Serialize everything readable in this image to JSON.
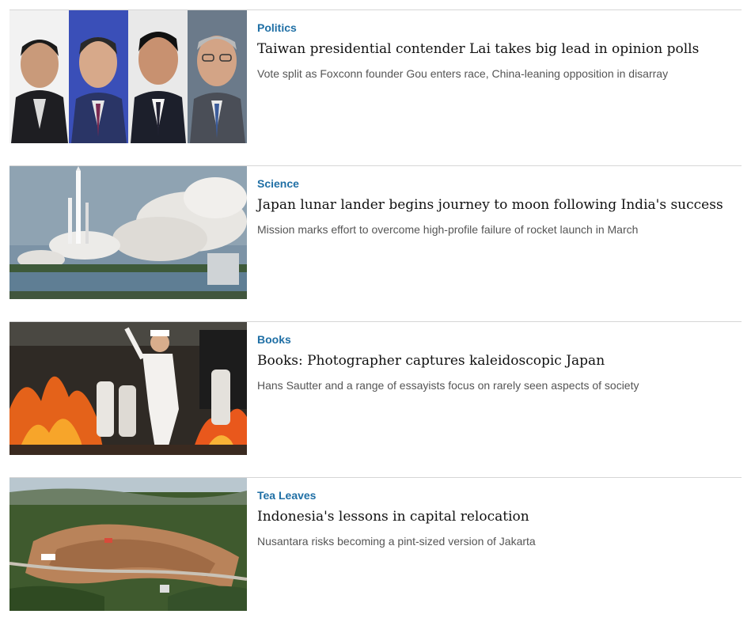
{
  "articles": [
    {
      "category": "Politics",
      "headline": "Taiwan presidential contender Lai takes big lead in opinion polls",
      "summary": "Vote split as Foxconn founder Gou enters race, China-leaning opposition in disarray",
      "image": "four-politicians-portraits"
    },
    {
      "category": "Science",
      "headline": "Japan lunar lander begins journey to moon following India's success",
      "summary": "Mission marks effort to overcome high-profile failure of rocket launch in March",
      "image": "rocket-launch-coastline"
    },
    {
      "category": "Books",
      "headline": "Books: Photographer captures kaleidoscopic Japan",
      "summary": "Hans Sautter and a range of essayists focus on rarely seen aspects of society",
      "image": "fire-walking-festival"
    },
    {
      "category": "Tea Leaves",
      "headline": "Indonesia's lessons in capital relocation",
      "summary": "Nusantara risks becoming a pint-sized version of Jakarta",
      "image": "forest-construction-site-aerial"
    }
  ],
  "colors": {
    "category": "#1f6fa5",
    "headline": "#111111",
    "summary": "#555555",
    "divider": "#d6d6d6"
  }
}
